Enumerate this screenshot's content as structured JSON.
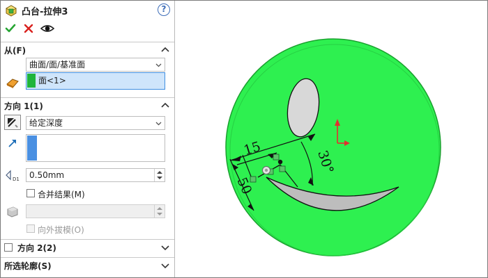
{
  "panel": {
    "title": "凸台-拉伸3",
    "help_symbol": "?",
    "ok_icon": "check-icon",
    "cancel_icon": "close-icon",
    "preview_icon": "eye-icon"
  },
  "from_section": {
    "header": "从(F)",
    "start_condition": "曲面/面/基准面",
    "selection_value": "面<1>",
    "selection_color": "#1fb53c"
  },
  "direction1": {
    "header": "方向 1(1)",
    "end_condition": "给定深度",
    "direction_list_color": "#4a90e2",
    "depth": "0.50mm",
    "merge_result_label": "合并结果(M)",
    "merge_result_checked": false,
    "draft_label": "向外拔模(O)",
    "draft_checked": false
  },
  "direction2": {
    "header": "方向 2(2)",
    "checked": false
  },
  "contours_section": {
    "header": "所选轮廓(S)"
  },
  "viewport": {
    "body_color": "#2ef050",
    "dimension_15": "15",
    "dimension_30deg": "30°",
    "dimension_50": "50"
  }
}
